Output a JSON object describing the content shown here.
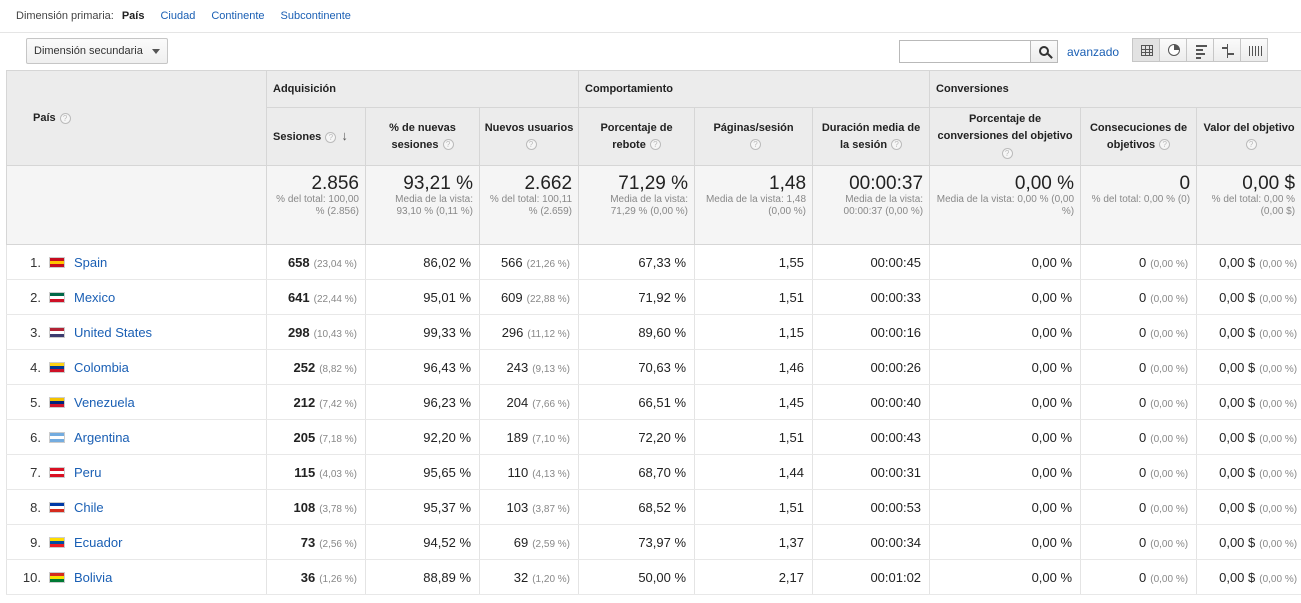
{
  "primary_dimension": {
    "label": "Dimensión primaria:",
    "active": "País",
    "options": [
      "Ciudad",
      "Continente",
      "Subcontinente"
    ]
  },
  "toolbar": {
    "secondary_dimension": "Dimensión secundaria",
    "search_value": "",
    "advanced": "avanzado"
  },
  "table": {
    "dim_header": "País",
    "groups": {
      "acq": "Adquisición",
      "beh": "Comportamiento",
      "conv": "Conversiones"
    },
    "columns": {
      "sessions": "Sesiones",
      "new_sessions": "% de nuevas sesiones",
      "new_users": "Nuevos usuarios",
      "bounce": "Porcentaje de rebote",
      "pages": "Páginas/sesión",
      "duration": "Duración media de la sesión",
      "conv_rate": "Porcentaje de conversiones del objetivo",
      "completions": "Consecuciones de objetivos",
      "goal_value": "Valor del objetivo"
    },
    "totals": {
      "sessions": {
        "value": "2.856",
        "sub": "% del total: 100,00 % (2.856)"
      },
      "new_sessions": {
        "value": "93,21 %",
        "sub": "Media de la vista: 93,10 % (0,11 %)"
      },
      "new_users": {
        "value": "2.662",
        "sub": "% del total: 100,11 % (2.659)"
      },
      "bounce": {
        "value": "71,29 %",
        "sub": "Media de la vista: 71,29 % (0,00 %)"
      },
      "pages": {
        "value": "1,48",
        "sub": "Media de la vista: 1,48 (0,00 %)"
      },
      "duration": {
        "value": "00:00:37",
        "sub": "Media de la vista: 00:00:37 (0,00 %)"
      },
      "conv_rate": {
        "value": "0,00 %",
        "sub": "Media de la vista: 0,00 % (0,00 %)"
      },
      "completions": {
        "value": "0",
        "sub": "% del total: 0,00 % (0)"
      },
      "goal_value": {
        "value": "0,00 $",
        "sub": "% del total: 0,00 % (0,00 $)"
      }
    },
    "rows": [
      {
        "n": "1.",
        "country": "Spain",
        "flag": "flag-spain",
        "flag_colors": [
          "#c60b1e",
          "#ffc400",
          "#c60b1e"
        ],
        "sessions": "658",
        "sessions_pct": "(23,04 %)",
        "new_sessions": "86,02 %",
        "new_users": "566",
        "new_users_pct": "(21,26 %)",
        "bounce": "67,33 %",
        "pages": "1,55",
        "duration": "00:00:45",
        "conv_rate": "0,00 %",
        "completions": "0",
        "completions_pct": "(0,00 %)",
        "goal_value": "0,00 $",
        "goal_value_pct": "(0,00 %)"
      },
      {
        "n": "2.",
        "country": "Mexico",
        "flag": "flag-mexico",
        "flag_colors": [
          "#006847",
          "#ffffff",
          "#ce1126"
        ],
        "sessions": "641",
        "sessions_pct": "(22,44 %)",
        "new_sessions": "95,01 %",
        "new_users": "609",
        "new_users_pct": "(22,88 %)",
        "bounce": "71,92 %",
        "pages": "1,51",
        "duration": "00:00:33",
        "conv_rate": "0,00 %",
        "completions": "0",
        "completions_pct": "(0,00 %)",
        "goal_value": "0,00 $",
        "goal_value_pct": "(0,00 %)"
      },
      {
        "n": "3.",
        "country": "United States",
        "flag": "flag-united-states",
        "flag_colors": [
          "#b22234",
          "#ffffff",
          "#3c3b6e"
        ],
        "sessions": "298",
        "sessions_pct": "(10,43 %)",
        "new_sessions": "99,33 %",
        "new_users": "296",
        "new_users_pct": "(11,12 %)",
        "bounce": "89,60 %",
        "pages": "1,15",
        "duration": "00:00:16",
        "conv_rate": "0,00 %",
        "completions": "0",
        "completions_pct": "(0,00 %)",
        "goal_value": "0,00 $",
        "goal_value_pct": "(0,00 %)"
      },
      {
        "n": "4.",
        "country": "Colombia",
        "flag": "flag-colombia",
        "flag_colors": [
          "#fcd116",
          "#003893",
          "#ce1126"
        ],
        "sessions": "252",
        "sessions_pct": "(8,82 %)",
        "new_sessions": "96,43 %",
        "new_users": "243",
        "new_users_pct": "(9,13 %)",
        "bounce": "70,63 %",
        "pages": "1,46",
        "duration": "00:00:26",
        "conv_rate": "0,00 %",
        "completions": "0",
        "completions_pct": "(0,00 %)",
        "goal_value": "0,00 $",
        "goal_value_pct": "(0,00 %)"
      },
      {
        "n": "5.",
        "country": "Venezuela",
        "flag": "flag-venezuela",
        "flag_colors": [
          "#f4c300",
          "#00247d",
          "#cf142b"
        ],
        "sessions": "212",
        "sessions_pct": "(7,42 %)",
        "new_sessions": "96,23 %",
        "new_users": "204",
        "new_users_pct": "(7,66 %)",
        "bounce": "66,51 %",
        "pages": "1,45",
        "duration": "00:00:40",
        "conv_rate": "0,00 %",
        "completions": "0",
        "completions_pct": "(0,00 %)",
        "goal_value": "0,00 $",
        "goal_value_pct": "(0,00 %)"
      },
      {
        "n": "6.",
        "country": "Argentina",
        "flag": "flag-argentina",
        "flag_colors": [
          "#74acdf",
          "#ffffff",
          "#74acdf"
        ],
        "sessions": "205",
        "sessions_pct": "(7,18 %)",
        "new_sessions": "92,20 %",
        "new_users": "189",
        "new_users_pct": "(7,10 %)",
        "bounce": "72,20 %",
        "pages": "1,51",
        "duration": "00:00:43",
        "conv_rate": "0,00 %",
        "completions": "0",
        "completions_pct": "(0,00 %)",
        "goal_value": "0,00 $",
        "goal_value_pct": "(0,00 %)"
      },
      {
        "n": "7.",
        "country": "Peru",
        "flag": "flag-peru",
        "flag_colors": [
          "#d91023",
          "#ffffff",
          "#d91023"
        ],
        "sessions": "115",
        "sessions_pct": "(4,03 %)",
        "new_sessions": "95,65 %",
        "new_users": "110",
        "new_users_pct": "(4,13 %)",
        "bounce": "68,70 %",
        "pages": "1,44",
        "duration": "00:00:31",
        "conv_rate": "0,00 %",
        "completions": "0",
        "completions_pct": "(0,00 %)",
        "goal_value": "0,00 $",
        "goal_value_pct": "(0,00 %)"
      },
      {
        "n": "8.",
        "country": "Chile",
        "flag": "flag-chile",
        "flag_colors": [
          "#0039a6",
          "#ffffff",
          "#d52b1e"
        ],
        "sessions": "108",
        "sessions_pct": "(3,78 %)",
        "new_sessions": "95,37 %",
        "new_users": "103",
        "new_users_pct": "(3,87 %)",
        "bounce": "68,52 %",
        "pages": "1,51",
        "duration": "00:00:53",
        "conv_rate": "0,00 %",
        "completions": "0",
        "completions_pct": "(0,00 %)",
        "goal_value": "0,00 $",
        "goal_value_pct": "(0,00 %)"
      },
      {
        "n": "9.",
        "country": "Ecuador",
        "flag": "flag-ecuador",
        "flag_colors": [
          "#ffdd00",
          "#034ea2",
          "#ed1c24"
        ],
        "sessions": "73",
        "sessions_pct": "(2,56 %)",
        "new_sessions": "94,52 %",
        "new_users": "69",
        "new_users_pct": "(2,59 %)",
        "bounce": "73,97 %",
        "pages": "1,37",
        "duration": "00:00:34",
        "conv_rate": "0,00 %",
        "completions": "0",
        "completions_pct": "(0,00 %)",
        "goal_value": "0,00 $",
        "goal_value_pct": "(0,00 %)"
      },
      {
        "n": "10.",
        "country": "Bolivia",
        "flag": "flag-bolivia",
        "flag_colors": [
          "#d52b1e",
          "#f9e300",
          "#007934"
        ],
        "sessions": "36",
        "sessions_pct": "(1,26 %)",
        "new_sessions": "88,89 %",
        "new_users": "32",
        "new_users_pct": "(1,20 %)",
        "bounce": "50,00 %",
        "pages": "2,17",
        "duration": "00:01:02",
        "conv_rate": "0,00 %",
        "completions": "0",
        "completions_pct": "(0,00 %)",
        "goal_value": "0,00 $",
        "goal_value_pct": "(0,00 %)"
      }
    ]
  }
}
